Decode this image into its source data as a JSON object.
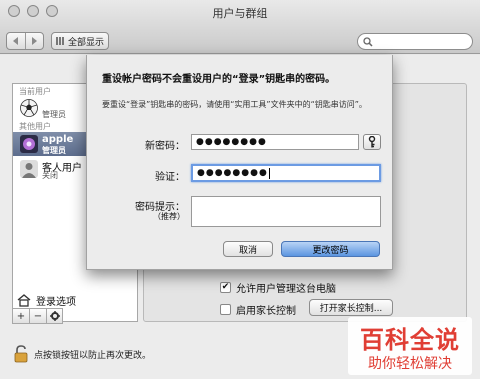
{
  "window": {
    "title": "用户与群组"
  },
  "toolbar": {
    "show_all_label": "全部显示",
    "back_icon": "chevron-left-icon",
    "forward_icon": "chevron-right-icon",
    "search_placeholder": ""
  },
  "sidebar": {
    "current_user_label": "当前用户",
    "current_user": {
      "name": "",
      "role": "管理员"
    },
    "other_users_label": "其他用户",
    "other_users": [
      {
        "name": "apple",
        "role": "管理员",
        "selected": true
      },
      {
        "name": "客人用户",
        "role": "关闭",
        "selected": false
      }
    ],
    "login_options_label": "登录选项",
    "add_label": "+",
    "remove_label": "−",
    "action_label": "✲"
  },
  "main": {
    "allow_admin_label": "允许用户管理这台电脑",
    "allow_admin_checked": true,
    "parental_label": "启用家长控制",
    "parental_checked": false,
    "open_parental_label": "打开家长控制..."
  },
  "footer": {
    "lock_text": "点按锁按钮以防止再次更改。"
  },
  "sheet": {
    "title": "重设帐户密码不会重设用户的“登录”钥匙串的密码。",
    "description": "要重设“登录”钥匙串的密码，请使用“实用工具”文件夹中的“钥匙串访问”。",
    "new_password_label": "新密码：",
    "new_password_value": "●●●●●●●●",
    "verify_label": "验证：",
    "verify_value": "●●●●●●●●",
    "hint_label": "密码提示：",
    "hint_sublabel": "（推荐）",
    "hint_value": "",
    "cancel_label": "取消",
    "change_label": "更改密码"
  },
  "watermark": {
    "main": "百科全说",
    "sub": "助你轻松解决"
  },
  "colors": {
    "accent_blue": "#5b95e0",
    "focus_ring": "#6c9be3",
    "watermark_red": "#e0352b",
    "selection": "#6e7d9c"
  }
}
